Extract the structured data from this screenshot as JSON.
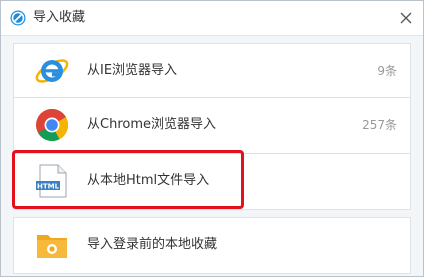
{
  "window": {
    "title": "导入收藏",
    "app_icon": "browser-logo-icon",
    "close_icon": "close-icon"
  },
  "import_options": [
    {
      "label": "从IE浏览器导入",
      "count": "9条",
      "icon": "internet-explorer-icon"
    },
    {
      "label": "从Chrome浏览器导入",
      "count": "257条",
      "icon": "chrome-icon"
    },
    {
      "label": "从本地Html文件导入",
      "count": "",
      "icon": "html-file-icon"
    },
    {
      "label": "导入登录前的本地收藏",
      "count": "",
      "icon": "local-folder-icon"
    }
  ],
  "annotation": {
    "highlight_color": "#e4101d",
    "highlighted_item": "从本地Html文件导入"
  },
  "colors": {
    "accent": "#1a8ce0",
    "highlight": "#e4101d"
  }
}
